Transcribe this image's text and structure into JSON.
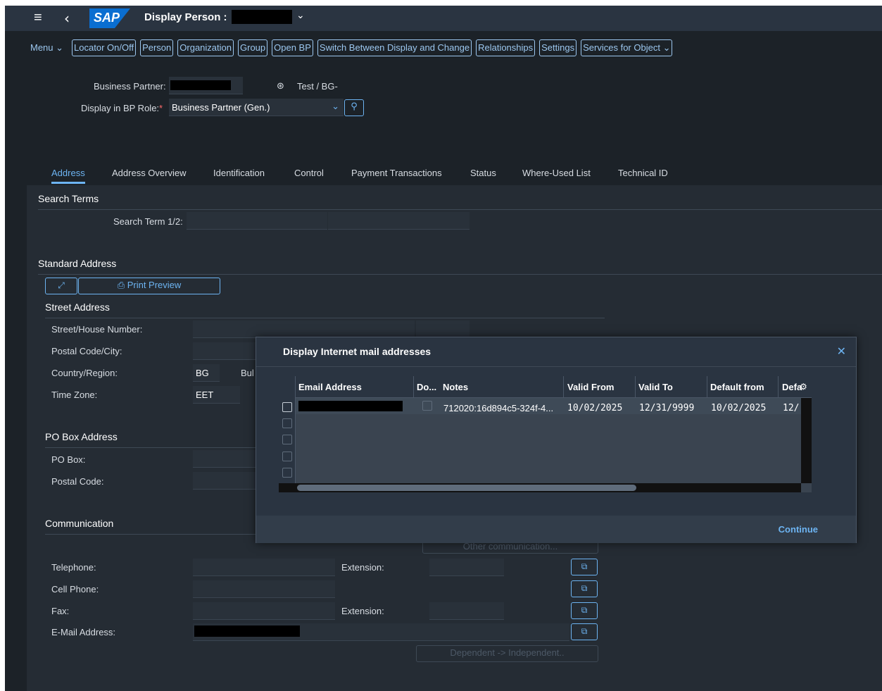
{
  "shell": {
    "title": "Display Person :",
    "logo": "SAP"
  },
  "toolbar": {
    "menu": "Menu",
    "buttons": [
      "Locator On/Off",
      "Person",
      "Organization",
      "Group",
      "Open BP",
      "Switch Between Display and Change",
      "Relationships",
      "Settings",
      "Services for Object"
    ]
  },
  "header": {
    "bp_label": "Business Partner:",
    "bp_name": "Test / BG-",
    "role_label": "Display in BP Role:",
    "role_value": "Business Partner (Gen.)"
  },
  "tabs": [
    "Address",
    "Address Overview",
    "Identification",
    "Control",
    "Payment Transactions",
    "Status",
    "Where-Used List",
    "Technical ID"
  ],
  "search": {
    "title": "Search Terms",
    "label": "Search Term 1/2:"
  },
  "standard": {
    "title": "Standard Address",
    "print_preview": "Print Preview"
  },
  "street": {
    "title": "Street Address",
    "street_label": "Street/House Number:",
    "postal_label": "Postal Code/City:",
    "country_label": "Country/Region:",
    "country_value": "BG",
    "country_name": "Bul",
    "tz_label": "Time Zone:",
    "tz_value": "EET"
  },
  "pobox": {
    "title": "PO Box Address",
    "pobox_label": "PO Box:",
    "postal_label": "Postal Code:"
  },
  "comm": {
    "title": "Communication",
    "other_btn": "Other communication...",
    "telephone": "Telephone:",
    "extension": "Extension:",
    "cell": "Cell Phone:",
    "fax": "Fax:",
    "fax_ext": "Extension:",
    "email": "E-Mail Address:",
    "dep_btn": "Dependent -> Independent.."
  },
  "dialog": {
    "title": "Display Internet mail addresses",
    "continue": "Continue",
    "columns": [
      "Email Address",
      "Do...",
      "Notes",
      "Valid From",
      "Valid To",
      "Default from",
      "Defa"
    ],
    "row": {
      "notes": "712020:16d894c5-324f-4...",
      "valid_from": "10/02/2025",
      "valid_to": "12/31/9999",
      "default_from": "10/02/2025",
      "default_to": "12/"
    }
  },
  "colors": {
    "accent": "#6db4f2",
    "background": "#1c2228",
    "shell": "#2a3441"
  }
}
